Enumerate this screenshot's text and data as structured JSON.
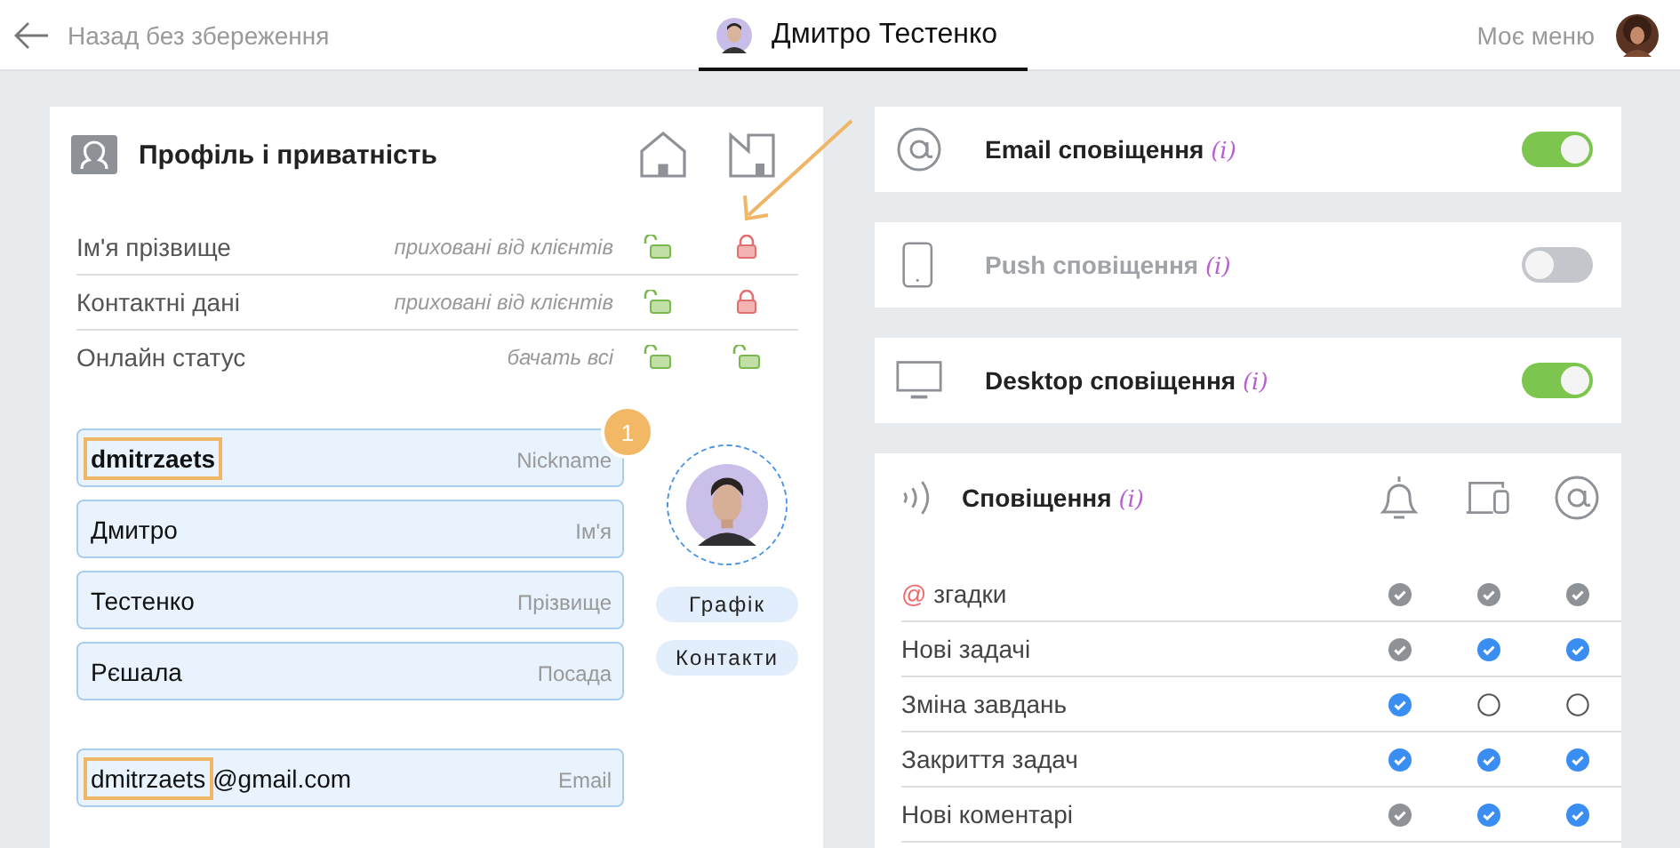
{
  "header": {
    "back_label": "Назад без збереження",
    "user_name": "Дмитро Тестенко",
    "menu_label": "Моє меню"
  },
  "profile": {
    "title": "Профіль і приватність",
    "privacy_columns": [
      {
        "kind": "house"
      },
      {
        "kind": "building"
      }
    ],
    "privacy_rows": [
      {
        "label": "Ім'я прізвище",
        "hint": "приховані від клієнтів",
        "locks": [
          {
            "locked": false
          },
          {
            "locked": true
          }
        ]
      },
      {
        "label": "Контактні дані",
        "hint": "приховані від клієнтів",
        "locks": [
          {
            "locked": false
          },
          {
            "locked": true
          }
        ]
      },
      {
        "label": "Онлайн статус",
        "hint": "бачать всі",
        "locks": [
          {
            "locked": false
          },
          {
            "locked": false
          }
        ]
      }
    ],
    "fields": [
      {
        "parts": [
          {
            "text": "dmitrzaets",
            "highlighted": true
          }
        ],
        "placeholder": "Nickname",
        "bold": true
      },
      {
        "parts": [
          {
            "text": "Дмитро",
            "highlighted": false
          }
        ],
        "placeholder": "Ім'я",
        "bold": false
      },
      {
        "parts": [
          {
            "text": "Тестенко",
            "highlighted": false
          }
        ],
        "placeholder": "Прізвище",
        "bold": false
      },
      {
        "parts": [
          {
            "text": "Рєшала",
            "highlighted": false
          }
        ],
        "placeholder": "Посада",
        "bold": false
      }
    ],
    "contact_fields": [
      {
        "parts": [
          {
            "text": "dmitrzaets",
            "highlighted": true
          },
          {
            "text": "@gmail.com",
            "highlighted": false
          }
        ],
        "placeholder": "Email",
        "bold": false
      }
    ],
    "badge": "1",
    "side_buttons": [
      "Графік",
      "Контакти"
    ]
  },
  "channels": [
    {
      "kind": "email",
      "label": "Email сповіщення",
      "info": "(i)",
      "on": true
    },
    {
      "kind": "push",
      "label": "Push сповіщення",
      "info": "(i)",
      "on": false
    },
    {
      "kind": "desktop",
      "label": "Desktop сповіщення",
      "info": "(i)",
      "on": true
    }
  ],
  "notifications": {
    "title": "Сповіщення",
    "info": "(i)",
    "columns": [
      {
        "kind": "bell"
      },
      {
        "kind": "devices"
      },
      {
        "kind": "at"
      }
    ],
    "rows": [
      {
        "prefix": "@",
        "label": "згадки",
        "checks": [
          {
            "checked": true,
            "disabled": true
          },
          {
            "checked": true,
            "disabled": true
          },
          {
            "checked": true,
            "disabled": true
          }
        ]
      },
      {
        "label": "Нові задачі",
        "checks": [
          {
            "checked": true,
            "disabled": true
          },
          {
            "checked": true,
            "disabled": false
          },
          {
            "checked": true,
            "disabled": false
          }
        ]
      },
      {
        "label": "Зміна завдань",
        "checks": [
          {
            "checked": true,
            "disabled": false
          },
          {
            "checked": false,
            "disabled": false
          },
          {
            "checked": false,
            "disabled": false
          }
        ]
      },
      {
        "label": "Закриття задач",
        "checks": [
          {
            "checked": true,
            "disabled": false
          },
          {
            "checked": true,
            "disabled": false
          },
          {
            "checked": true,
            "disabled": false
          }
        ]
      },
      {
        "label": "Нові коментарі",
        "checks": [
          {
            "checked": true,
            "disabled": true
          },
          {
            "checked": true,
            "disabled": false
          },
          {
            "checked": true,
            "disabled": false
          }
        ]
      }
    ]
  }
}
